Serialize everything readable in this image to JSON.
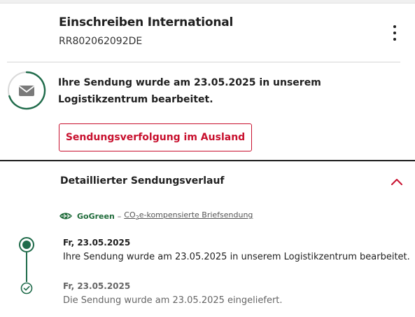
{
  "shipment": {
    "title": "Einschreiben International",
    "tracking_number": "RR802062092DE",
    "status_message": "Ihre Sendung wurde am 23.05.2025 in unserem Logistikzentrum bearbeitet.",
    "abroad_button_label": "Sendungsverfolgung im Ausland"
  },
  "history": {
    "title": "Detaillierter Sendungsverlauf",
    "gogreen": {
      "brand": "GoGreen",
      "separator": "–",
      "desc_prefix": "CO",
      "desc_sub": "2",
      "desc_suffix": "e-kompensierte Briefsendung"
    },
    "events": [
      {
        "date": "Fr, 23.05.2025",
        "text": "Ihre Sendung wurde am 23.05.2025 in unserem Logistikzentrum bearbeitet."
      },
      {
        "date": "Fr, 23.05.2025",
        "text": "Die Sendung wurde am 23.05.2025 eingeliefert."
      }
    ]
  },
  "icons": {
    "menu": "more-vertical-icon",
    "status": "envelope-icon",
    "collapse": "chevron-up-icon",
    "gogreen": "leaf-icon"
  },
  "colors": {
    "accent_red": "#c8102e",
    "status_green": "#1f6b4a",
    "text_dark": "#1f1f1f"
  }
}
